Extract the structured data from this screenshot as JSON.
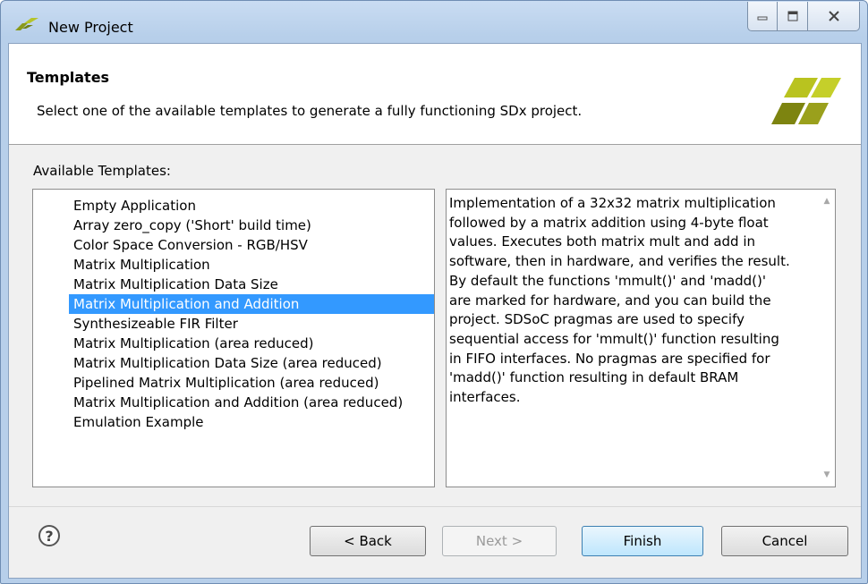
{
  "window": {
    "title": "New Project",
    "colors": {
      "frame": "#b7cfea",
      "selection": "#3399ff",
      "logo_green": "#9aa01c"
    }
  },
  "banner": {
    "title": "Templates",
    "description": "Select one of the available templates to generate a fully functioning SDx project."
  },
  "templates": {
    "label": "Available Templates:",
    "items": [
      "Empty Application",
      "Array zero_copy ('Short' build time)",
      "Color Space Conversion - RGB/HSV",
      "Matrix Multiplication",
      "Matrix Multiplication Data Size",
      "Matrix Multiplication and Addition",
      "Synthesizeable FIR Filter",
      "Matrix Multiplication (area reduced)",
      "Matrix Multiplication Data Size (area reduced)",
      "Pipelined Matrix Multiplication (area reduced)",
      "Matrix Multiplication and Addition (area reduced)",
      "Emulation Example"
    ],
    "selected_index": 5
  },
  "description_lines": [
    "Implementation of a 32x32 matrix multiplication",
    "followed by a matrix addition using 4-byte float",
    "values. Executes both matrix mult and add in",
    "software, then in hardware, and verifies the result.",
    "By default the functions 'mmult()' and 'madd()'",
    "are marked for hardware, and you can build the",
    "project. SDSoC pragmas are used to specify",
    "sequential access for 'mmult()' function resulting",
    "in FIFO interfaces. No pragmas are specified for",
    "'madd()' function resulting in default BRAM",
    "interfaces."
  ],
  "buttons": {
    "help": "?",
    "back": "< Back",
    "next": "Next >",
    "finish": "Finish",
    "cancel": "Cancel"
  }
}
